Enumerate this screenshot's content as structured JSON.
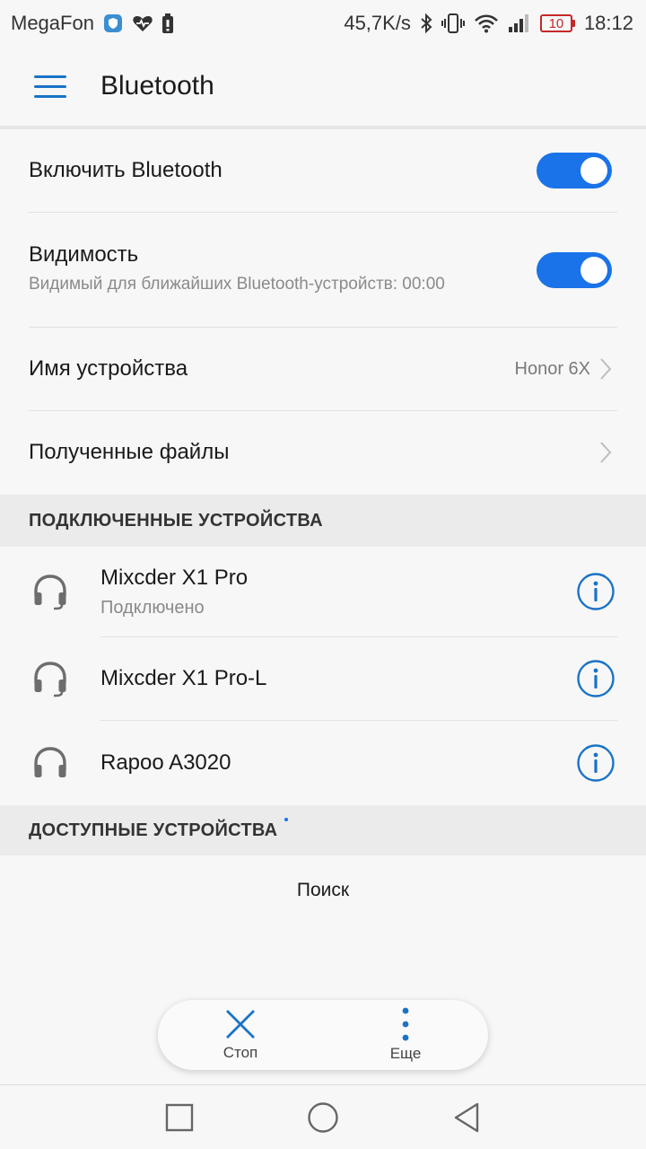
{
  "status_bar": {
    "carrier": "MegaFon",
    "network_speed": "45,7K/s",
    "battery_level": "10",
    "time": "18:12"
  },
  "app_bar": {
    "title": "Bluetooth"
  },
  "settings": {
    "enable_bluetooth": {
      "label": "Включить Bluetooth",
      "on": true
    },
    "visibility": {
      "label": "Видимость",
      "sub": "Видимый для ближайших Bluetooth-устройств: 00:00",
      "on": true
    },
    "device_name": {
      "label": "Имя устройства",
      "value": "Honor 6X"
    },
    "received_files": {
      "label": "Полученные файлы"
    }
  },
  "connected_section": {
    "title": "ПОДКЛЮЧЕННЫЕ УСТРОЙСТВА",
    "devices": [
      {
        "name": "Mixcder X1 Pro",
        "status": "Подключено"
      },
      {
        "name": "Mixcder X1 Pro-L",
        "status": ""
      },
      {
        "name": "Rapoo A3020",
        "status": ""
      }
    ]
  },
  "available_section": {
    "title": "ДОСТУПНЫЕ УСТРОЙСТВА",
    "search_label": "Поиск"
  },
  "actions": {
    "stop_label": "Стоп",
    "more_label": "Еще"
  },
  "colors": {
    "accent": "#1a73e8",
    "battery_low": "#c62828"
  }
}
